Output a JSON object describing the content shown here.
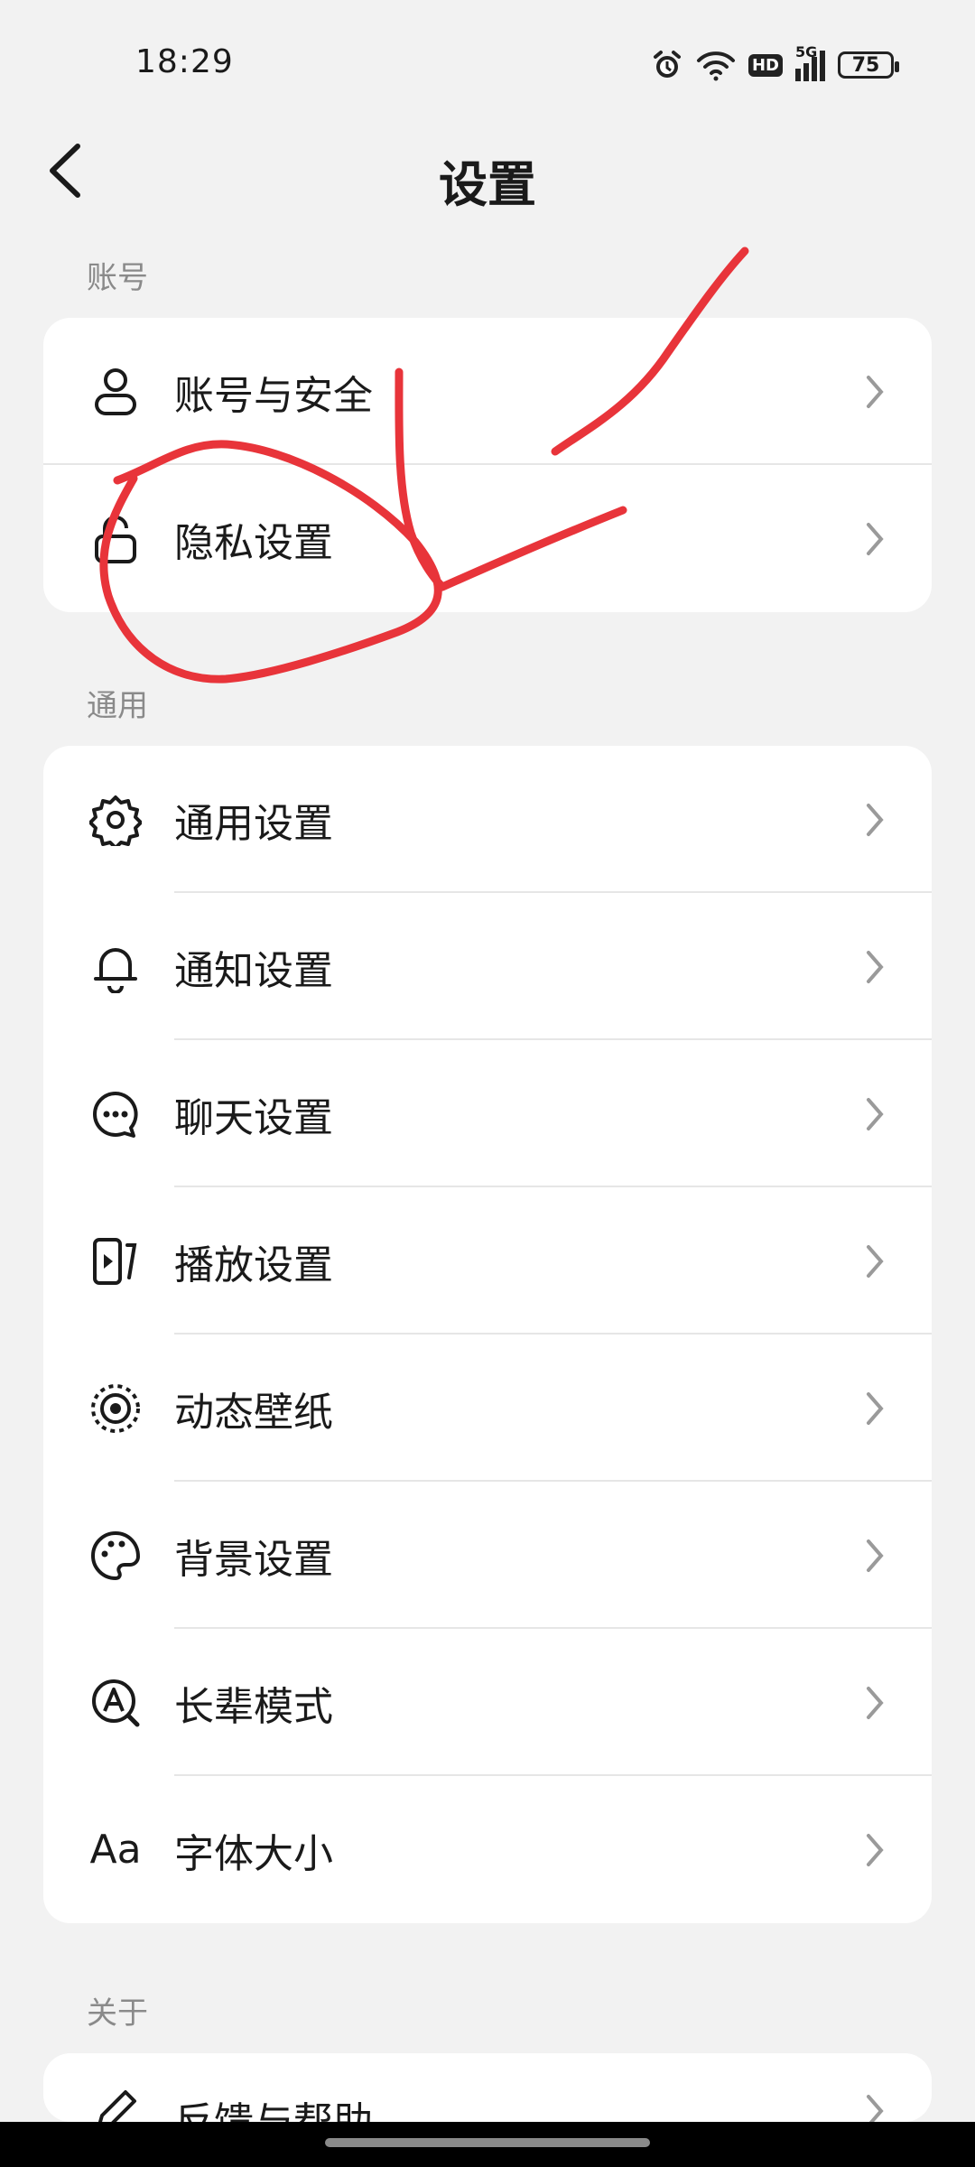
{
  "status_bar": {
    "time": "18:29",
    "battery": "75",
    "network": "5G",
    "hd": "HD"
  },
  "header": {
    "title": "设置"
  },
  "sections": [
    {
      "label": "账号",
      "items": [
        {
          "label": "账号与安全",
          "icon": "user-icon"
        },
        {
          "label": "隐私设置",
          "icon": "lock-icon"
        }
      ]
    },
    {
      "label": "通用",
      "items": [
        {
          "label": "通用设置",
          "icon": "gear-icon"
        },
        {
          "label": "通知设置",
          "icon": "bell-icon"
        },
        {
          "label": "聊天设置",
          "icon": "chat-bubble-icon"
        },
        {
          "label": "播放设置",
          "icon": "play-screen-icon"
        },
        {
          "label": "动态壁纸",
          "icon": "target-icon"
        },
        {
          "label": "背景设置",
          "icon": "palette-icon"
        },
        {
          "label": "长辈模式",
          "icon": "elder-mode-icon"
        },
        {
          "label": "字体大小",
          "icon": "font-size-icon",
          "icon_text": "Aa"
        }
      ]
    },
    {
      "label": "关于",
      "items": [
        {
          "label": "反馈与帮助",
          "icon": "pen-icon"
        }
      ]
    }
  ],
  "colors": {
    "background": "#f2f2f2",
    "card": "#ffffff",
    "annotation": "#e8343a",
    "section_label": "#8a8a8a"
  }
}
